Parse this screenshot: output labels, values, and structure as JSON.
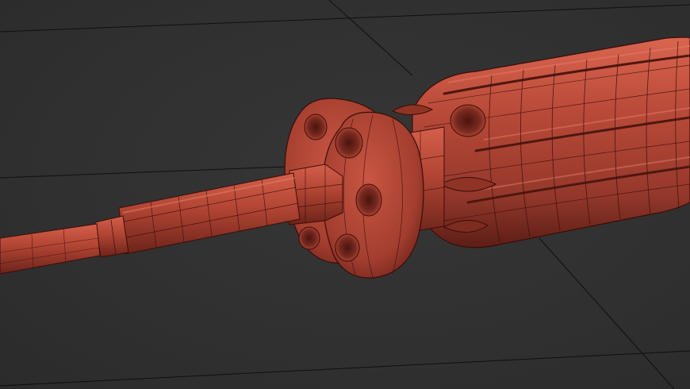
{
  "viewport": {
    "background_color": "#2f2f2f",
    "grid_line_color": "#0f0f0f",
    "model": {
      "name": "",
      "base_color": "#b24434",
      "highlight_color": "#d9654f",
      "shadow_color": "#5c1d16",
      "wire_color": "#3a0d08",
      "display_mode": "shaded-wireframe"
    }
  }
}
